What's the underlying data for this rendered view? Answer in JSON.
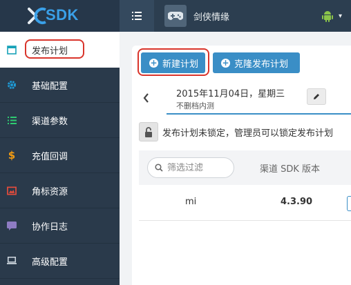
{
  "brand": {
    "logo_text": "SDK",
    "accent": "#3aa0e8"
  },
  "topbar": {
    "menu_icon": "list-icon",
    "app_icon": "gamepad-icon",
    "app_name": "剑侠情缘",
    "platform_icon": "android-icon"
  },
  "sidebar": {
    "items": [
      {
        "label": "发布计划",
        "icon": "calendar-icon",
        "active": true
      },
      {
        "label": "基础配置",
        "icon": "gear-icon"
      },
      {
        "label": "渠道参数",
        "icon": "list-icon"
      },
      {
        "label": "充值回调",
        "icon": "dollar-icon"
      },
      {
        "label": "角标资源",
        "icon": "image-icon"
      },
      {
        "label": "协作日志",
        "icon": "comment-icon"
      },
      {
        "label": "高级配置",
        "icon": "laptop-icon"
      }
    ]
  },
  "actions": {
    "new_plan": "新建计划",
    "clone_plan": "克隆发布计划"
  },
  "date_nav": {
    "date": "2015年11月04日，星期三",
    "note": "不删档内测"
  },
  "lock": {
    "message": "发布计划未锁定，管理员可以锁定发布计划"
  },
  "table": {
    "filter_placeholder": "筛选过滤",
    "column": "渠道 SDK 版本",
    "rows": [
      {
        "channel": "mi",
        "version": "4.3.90"
      }
    ]
  },
  "colors": {
    "primary": "#3a8ec6",
    "highlight": "#d9342b",
    "sidebar": "#2a3a4b",
    "topbar": "#2c3e50"
  }
}
